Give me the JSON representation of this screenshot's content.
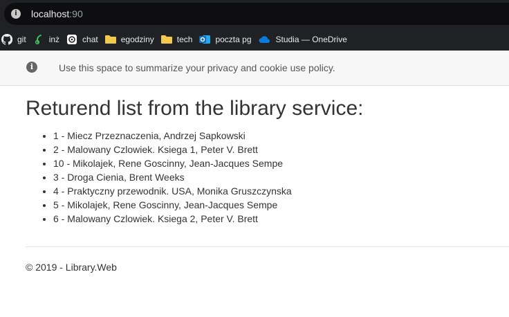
{
  "browser": {
    "url_host": "localhost",
    "url_port": ":90",
    "bookmarks": [
      {
        "label": "git",
        "icon": "github-icon"
      },
      {
        "label": "inż",
        "icon": "leaf-icon"
      },
      {
        "label": "chat",
        "icon": "chatgpt-icon"
      },
      {
        "label": "egodziny",
        "icon": "folder-icon"
      },
      {
        "label": "tech",
        "icon": "folder-icon"
      },
      {
        "label": "poczta pg",
        "icon": "outlook-icon"
      },
      {
        "label": "Studia — OneDrive",
        "icon": "onedrive-icon"
      }
    ]
  },
  "cookie": {
    "text": "Use this space to summarize your privacy and cookie use policy."
  },
  "main": {
    "title": "Returend list from the library service:",
    "books": [
      "1 - Miecz Przeznaczenia, Andrzej Sapkowski",
      "2 - Malowany Czlowiek. Ksiega 1, Peter V. Brett",
      "10 - Mikolajek, Rene Goscinny, Jean-Jacques Sempe",
      "3 - Droga Cienia, Brent Weeks",
      "4 - Praktyczny przewodnik. USA, Monika Gruszczynska",
      "5 - Mikolajek, Rene Goscinny, Jean-Jacques Sempe",
      "6 - Malowany Czlowiek. Ksiega 2, Peter V. Brett"
    ]
  },
  "footer": {
    "text": "© 2019 - Library.Web"
  },
  "colors": {
    "chrome_bg": "#202124",
    "folder": "#f2c94c",
    "outlook": "#0f6cbd",
    "onedrive": "#0a7bd8"
  }
}
